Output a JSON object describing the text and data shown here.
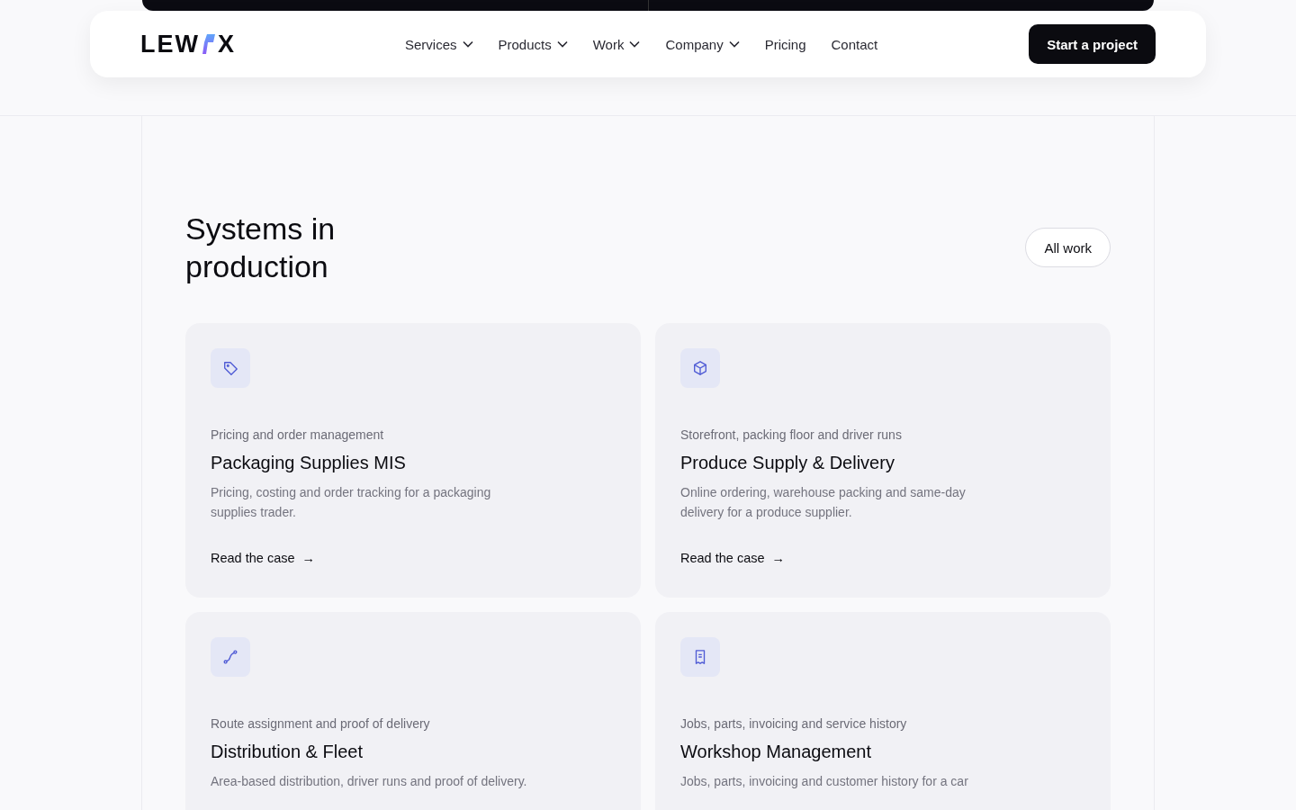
{
  "header": {
    "logo": {
      "left": "LEW",
      "right": "X"
    },
    "nav": [
      {
        "label": "Services",
        "dropdown": true
      },
      {
        "label": "Products",
        "dropdown": true
      },
      {
        "label": "Work",
        "dropdown": true
      },
      {
        "label": "Company",
        "dropdown": true
      },
      {
        "label": "Pricing",
        "dropdown": false
      },
      {
        "label": "Contact",
        "dropdown": false
      }
    ],
    "cta": "Start a project"
  },
  "section": {
    "title": "Systems in production",
    "button": "All work",
    "cards": [
      {
        "eyebrow": "Pricing and order management",
        "title": "Packaging Supplies MIS",
        "description": "Pricing, costing and order tracking for a packaging supplies trader.",
        "link": "Read the case",
        "arrow": "→"
      },
      {
        "eyebrow": "Storefront, packing floor and driver runs",
        "title": "Produce Supply & Delivery",
        "description": "Online ordering, warehouse packing and same-day delivery for a produce supplier.",
        "link": "Read the case",
        "arrow": "→"
      },
      {
        "eyebrow": "Route assignment and proof of delivery",
        "title": "Distribution & Fleet",
        "description": "Area-based distribution, driver runs and proof of delivery."
      },
      {
        "eyebrow": "Jobs, parts, invoicing and service history",
        "title": "Workshop Management",
        "description": "Jobs, parts, invoicing and customer history for a car"
      }
    ]
  }
}
